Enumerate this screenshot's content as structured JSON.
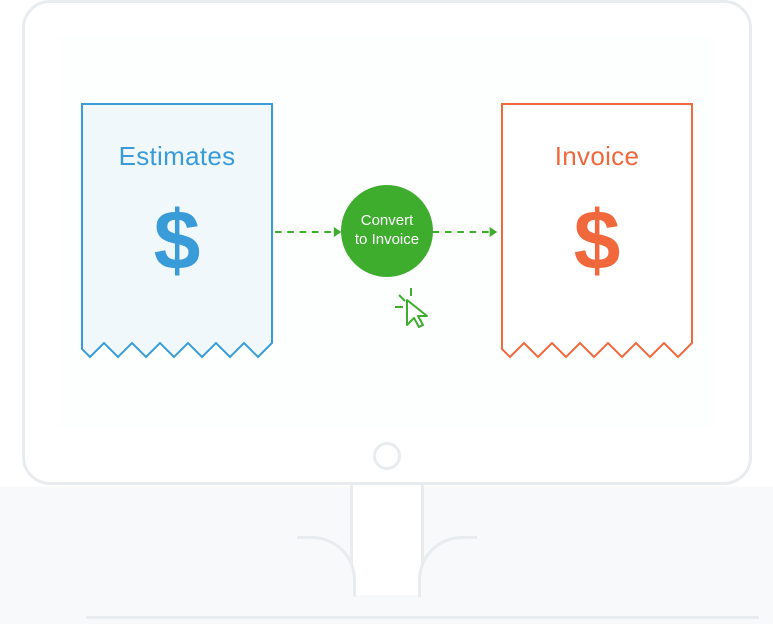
{
  "colors": {
    "estimate": "#3a9bd9",
    "estimate_fill": "#f1f8fb",
    "invoice": "#f0683c",
    "convert_green": "#3ead2e",
    "frame": "#e8ecef"
  },
  "estimate": {
    "title": "Estimates",
    "symbol": "$"
  },
  "invoice": {
    "title": "Invoice",
    "symbol": "$"
  },
  "convert": {
    "line1": "Convert",
    "line2": "to Invoice"
  }
}
